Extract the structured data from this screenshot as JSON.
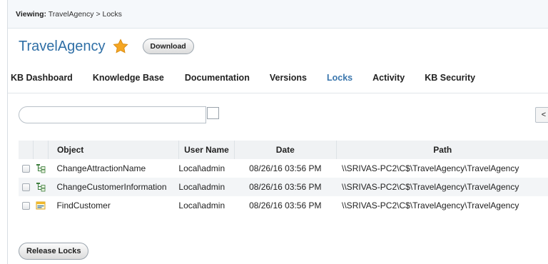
{
  "breadcrumb": {
    "label": "Viewing:",
    "path": "TravelAgency > Locks"
  },
  "kb": {
    "title": "TravelAgency",
    "download_label": "Download"
  },
  "tabs": [
    {
      "label": "KB Dashboard"
    },
    {
      "label": "Knowledge Base"
    },
    {
      "label": "Documentation"
    },
    {
      "label": "Versions"
    },
    {
      "label": "Locks",
      "active": true
    },
    {
      "label": "Activity"
    },
    {
      "label": "KB Security"
    }
  ],
  "search": {
    "placeholder": ""
  },
  "pager": {
    "prev_label": "<"
  },
  "table": {
    "columns": [
      "",
      "",
      "Object",
      "User Name",
      "Date",
      "Path"
    ],
    "rows": [
      {
        "icon": "procedure-icon",
        "object": "ChangeAttractionName",
        "user": "Local\\admin",
        "date": "08/26/16 03:56 PM",
        "path": "\\\\SRIVAS-PC2\\C$\\TravelAgency\\TravelAgency"
      },
      {
        "icon": "procedure-icon",
        "object": "ChangeCustomerInformation",
        "user": "Local\\admin",
        "date": "08/26/16 03:56 PM",
        "path": "\\\\SRIVAS-PC2\\C$\\TravelAgency\\TravelAgency"
      },
      {
        "icon": "webpanel-icon",
        "object": "FindCustomer",
        "user": "Local\\admin",
        "date": "08/26/16 03:56 PM",
        "path": "\\\\SRIVAS-PC2\\C$\\TravelAgency\\TravelAgency"
      }
    ]
  },
  "actions": {
    "release_label": "Release Locks"
  },
  "colors": {
    "accent": "#3a76ad",
    "title": "#2f6fa6",
    "star": "#f5a623"
  }
}
